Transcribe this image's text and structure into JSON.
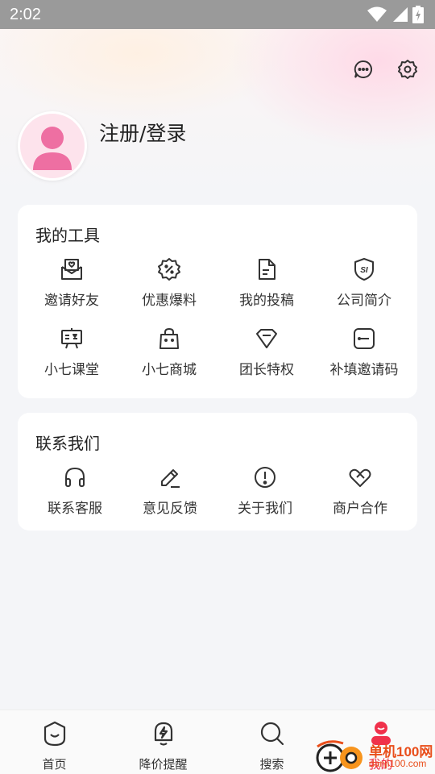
{
  "status_bar": {
    "time": "2:02"
  },
  "profile": {
    "login_label": "注册/登录"
  },
  "tools": {
    "title": "我的工具",
    "items": [
      {
        "label": "邀请好友",
        "icon": "invite-envelope-icon"
      },
      {
        "label": "优惠爆料",
        "icon": "discount-badge-icon"
      },
      {
        "label": "我的投稿",
        "icon": "document-icon"
      },
      {
        "label": "公司简介",
        "icon": "shield-si-icon"
      },
      {
        "label": "小七课堂",
        "icon": "classroom-board-icon"
      },
      {
        "label": "小七商城",
        "icon": "shopping-bag-icon"
      },
      {
        "label": "团长特权",
        "icon": "diamond-icon"
      },
      {
        "label": "补填邀请码",
        "icon": "code-box-icon"
      }
    ]
  },
  "contact": {
    "title": "联系我们",
    "items": [
      {
        "label": "联系客服",
        "icon": "headphones-icon"
      },
      {
        "label": "意见反馈",
        "icon": "pencil-icon"
      },
      {
        "label": "关于我们",
        "icon": "info-circle-icon"
      },
      {
        "label": "商户合作",
        "icon": "handshake-heart-icon"
      }
    ]
  },
  "bottom_nav": {
    "items": [
      {
        "label": "首页",
        "icon": "home-face-icon"
      },
      {
        "label": "降价提醒",
        "icon": "bell-bolt-icon"
      },
      {
        "label": "搜索",
        "icon": "search-icon"
      },
      {
        "label": "我的",
        "icon": "profile-icon",
        "active": true
      }
    ]
  },
  "watermark": {
    "text": "单机100网",
    "sub": "danji100.com"
  },
  "colors": {
    "accent": "#e8467a",
    "avatar_bg": "#fde3ec",
    "avatar_figure": "#ee6fa2",
    "active_nav": "#f0314b"
  }
}
